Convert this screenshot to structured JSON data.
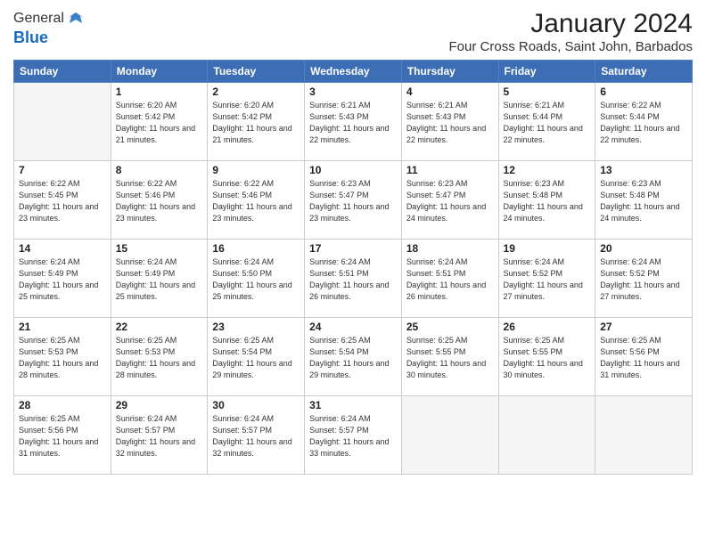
{
  "header": {
    "logo_general": "General",
    "logo_blue": "Blue",
    "month_title": "January 2024",
    "location": "Four Cross Roads, Saint John, Barbados"
  },
  "weekdays": [
    "Sunday",
    "Monday",
    "Tuesday",
    "Wednesday",
    "Thursday",
    "Friday",
    "Saturday"
  ],
  "weeks": [
    [
      {
        "day": "",
        "empty": true
      },
      {
        "day": "1",
        "sunrise": "6:20 AM",
        "sunset": "5:42 PM",
        "daylight": "11 hours and 21 minutes."
      },
      {
        "day": "2",
        "sunrise": "6:20 AM",
        "sunset": "5:42 PM",
        "daylight": "11 hours and 21 minutes."
      },
      {
        "day": "3",
        "sunrise": "6:21 AM",
        "sunset": "5:43 PM",
        "daylight": "11 hours and 22 minutes."
      },
      {
        "day": "4",
        "sunrise": "6:21 AM",
        "sunset": "5:43 PM",
        "daylight": "11 hours and 22 minutes."
      },
      {
        "day": "5",
        "sunrise": "6:21 AM",
        "sunset": "5:44 PM",
        "daylight": "11 hours and 22 minutes."
      },
      {
        "day": "6",
        "sunrise": "6:22 AM",
        "sunset": "5:44 PM",
        "daylight": "11 hours and 22 minutes."
      }
    ],
    [
      {
        "day": "7",
        "sunrise": "6:22 AM",
        "sunset": "5:45 PM",
        "daylight": "11 hours and 23 minutes."
      },
      {
        "day": "8",
        "sunrise": "6:22 AM",
        "sunset": "5:46 PM",
        "daylight": "11 hours and 23 minutes."
      },
      {
        "day": "9",
        "sunrise": "6:22 AM",
        "sunset": "5:46 PM",
        "daylight": "11 hours and 23 minutes."
      },
      {
        "day": "10",
        "sunrise": "6:23 AM",
        "sunset": "5:47 PM",
        "daylight": "11 hours and 23 minutes."
      },
      {
        "day": "11",
        "sunrise": "6:23 AM",
        "sunset": "5:47 PM",
        "daylight": "11 hours and 24 minutes."
      },
      {
        "day": "12",
        "sunrise": "6:23 AM",
        "sunset": "5:48 PM",
        "daylight": "11 hours and 24 minutes."
      },
      {
        "day": "13",
        "sunrise": "6:23 AM",
        "sunset": "5:48 PM",
        "daylight": "11 hours and 24 minutes."
      }
    ],
    [
      {
        "day": "14",
        "sunrise": "6:24 AM",
        "sunset": "5:49 PM",
        "daylight": "11 hours and 25 minutes."
      },
      {
        "day": "15",
        "sunrise": "6:24 AM",
        "sunset": "5:49 PM",
        "daylight": "11 hours and 25 minutes."
      },
      {
        "day": "16",
        "sunrise": "6:24 AM",
        "sunset": "5:50 PM",
        "daylight": "11 hours and 25 minutes."
      },
      {
        "day": "17",
        "sunrise": "6:24 AM",
        "sunset": "5:51 PM",
        "daylight": "11 hours and 26 minutes."
      },
      {
        "day": "18",
        "sunrise": "6:24 AM",
        "sunset": "5:51 PM",
        "daylight": "11 hours and 26 minutes."
      },
      {
        "day": "19",
        "sunrise": "6:24 AM",
        "sunset": "5:52 PM",
        "daylight": "11 hours and 27 minutes."
      },
      {
        "day": "20",
        "sunrise": "6:24 AM",
        "sunset": "5:52 PM",
        "daylight": "11 hours and 27 minutes."
      }
    ],
    [
      {
        "day": "21",
        "sunrise": "6:25 AM",
        "sunset": "5:53 PM",
        "daylight": "11 hours and 28 minutes."
      },
      {
        "day": "22",
        "sunrise": "6:25 AM",
        "sunset": "5:53 PM",
        "daylight": "11 hours and 28 minutes."
      },
      {
        "day": "23",
        "sunrise": "6:25 AM",
        "sunset": "5:54 PM",
        "daylight": "11 hours and 29 minutes."
      },
      {
        "day": "24",
        "sunrise": "6:25 AM",
        "sunset": "5:54 PM",
        "daylight": "11 hours and 29 minutes."
      },
      {
        "day": "25",
        "sunrise": "6:25 AM",
        "sunset": "5:55 PM",
        "daylight": "11 hours and 30 minutes."
      },
      {
        "day": "26",
        "sunrise": "6:25 AM",
        "sunset": "5:55 PM",
        "daylight": "11 hours and 30 minutes."
      },
      {
        "day": "27",
        "sunrise": "6:25 AM",
        "sunset": "5:56 PM",
        "daylight": "11 hours and 31 minutes."
      }
    ],
    [
      {
        "day": "28",
        "sunrise": "6:25 AM",
        "sunset": "5:56 PM",
        "daylight": "11 hours and 31 minutes."
      },
      {
        "day": "29",
        "sunrise": "6:24 AM",
        "sunset": "5:57 PM",
        "daylight": "11 hours and 32 minutes."
      },
      {
        "day": "30",
        "sunrise": "6:24 AM",
        "sunset": "5:57 PM",
        "daylight": "11 hours and 32 minutes."
      },
      {
        "day": "31",
        "sunrise": "6:24 AM",
        "sunset": "5:57 PM",
        "daylight": "11 hours and 33 minutes."
      },
      {
        "day": "",
        "empty": true
      },
      {
        "day": "",
        "empty": true
      },
      {
        "day": "",
        "empty": true
      }
    ]
  ]
}
